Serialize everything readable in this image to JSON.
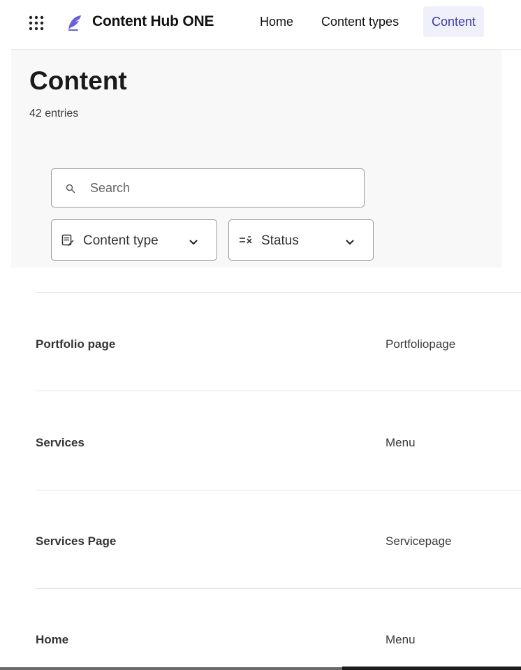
{
  "app": {
    "brand": "Content Hub ONE"
  },
  "nav": {
    "items": [
      {
        "label": "Home",
        "active": false
      },
      {
        "label": "Content types",
        "active": false
      },
      {
        "label": "Content",
        "active": true
      }
    ]
  },
  "header": {
    "title": "Content",
    "count": "42 entries"
  },
  "search": {
    "placeholder": "Search",
    "value": ""
  },
  "filters": {
    "content_type_label": "Content type",
    "status_label": "Status"
  },
  "table": {
    "rows": [
      {
        "name": "Portfolio page",
        "type": "Portfoliopage"
      },
      {
        "name": "Services",
        "type": "Menu"
      },
      {
        "name": "Services Page",
        "type": "Servicepage"
      },
      {
        "name": "Home",
        "type": "Menu"
      }
    ]
  },
  "colors": {
    "accent": "#6b5fe0",
    "active_nav_bg": "#f0f0fb",
    "active_nav_text": "#3f3aa6",
    "header_bg": "#f8f8f8"
  },
  "icons": {
    "apps": "grid-dots-icon",
    "logo": "quill-icon",
    "search": "search-icon",
    "content_type": "document-edit-icon",
    "status": "status-filter-icon",
    "chevron": "chevron-down-icon"
  }
}
